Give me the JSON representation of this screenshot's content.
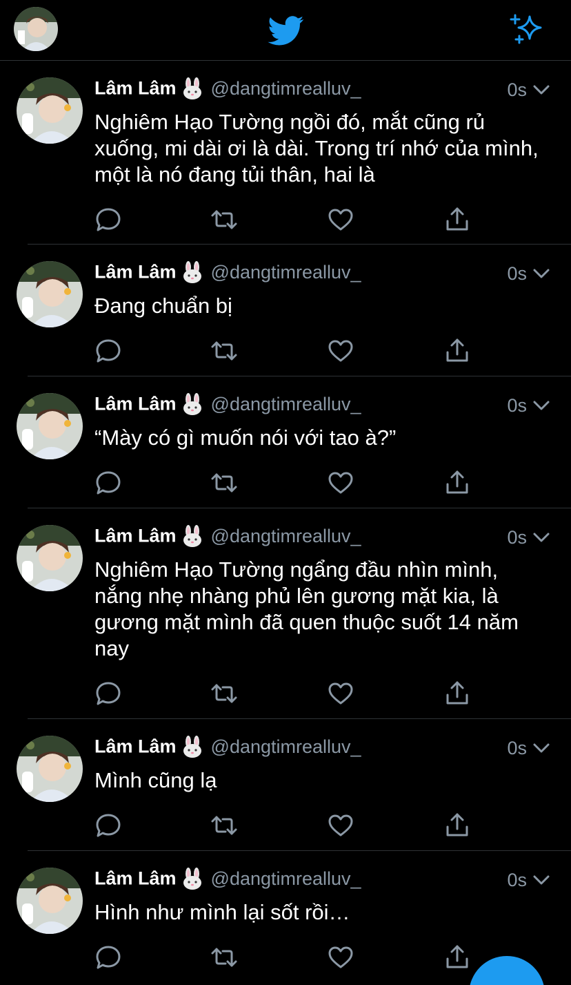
{
  "colors": {
    "background": "#000000",
    "accent": "#1d9bf0",
    "secondary_text": "#8b98a5",
    "divider": "#2f3336"
  },
  "top_bar": {
    "left_icon": "profile-avatar",
    "center_icon": "twitter-bird-icon",
    "right_icon": "sparkle-icon"
  },
  "tweets": [
    {
      "name": "Lâm Lâm",
      "emoji": "rabbit-face-icon",
      "handle": "@dangtimrealluv_",
      "time": "0s",
      "text": "Nghiêm Hạo Tường ngồi đó, mắt cũng rủ xuống, mi dài ơi là dài. Trong trí nhớ của mình, một là nó đang tủi thân, hai là"
    },
    {
      "name": "Lâm Lâm",
      "emoji": "rabbit-face-icon",
      "handle": "@dangtimrealluv_",
      "time": "0s",
      "text": "Đang chuẩn bị"
    },
    {
      "name": "Lâm Lâm",
      "emoji": "rabbit-face-icon",
      "handle": "@dangtimrealluv_",
      "time": "0s",
      "text": "“Mày có gì muốn nói với tao à?”"
    },
    {
      "name": "Lâm Lâm",
      "emoji": "rabbit-face-icon",
      "handle": "@dangtimrealluv_",
      "time": "0s",
      "text": "Nghiêm Hạo Tường ngẩng đầu nhìn mình, nắng nhẹ nhàng phủ lên gương mặt kia, là gương mặt mình đã quen thuộc suốt 14 năm nay"
    },
    {
      "name": "Lâm Lâm",
      "emoji": "rabbit-face-icon",
      "handle": "@dangtimrealluv_",
      "time": "0s",
      "text": "Mình cũng lạ"
    },
    {
      "name": "Lâm Lâm",
      "emoji": "rabbit-face-icon",
      "handle": "@dangtimrealluv_",
      "time": "0s",
      "text": "Hình như mình lại sốt rồi…"
    }
  ]
}
